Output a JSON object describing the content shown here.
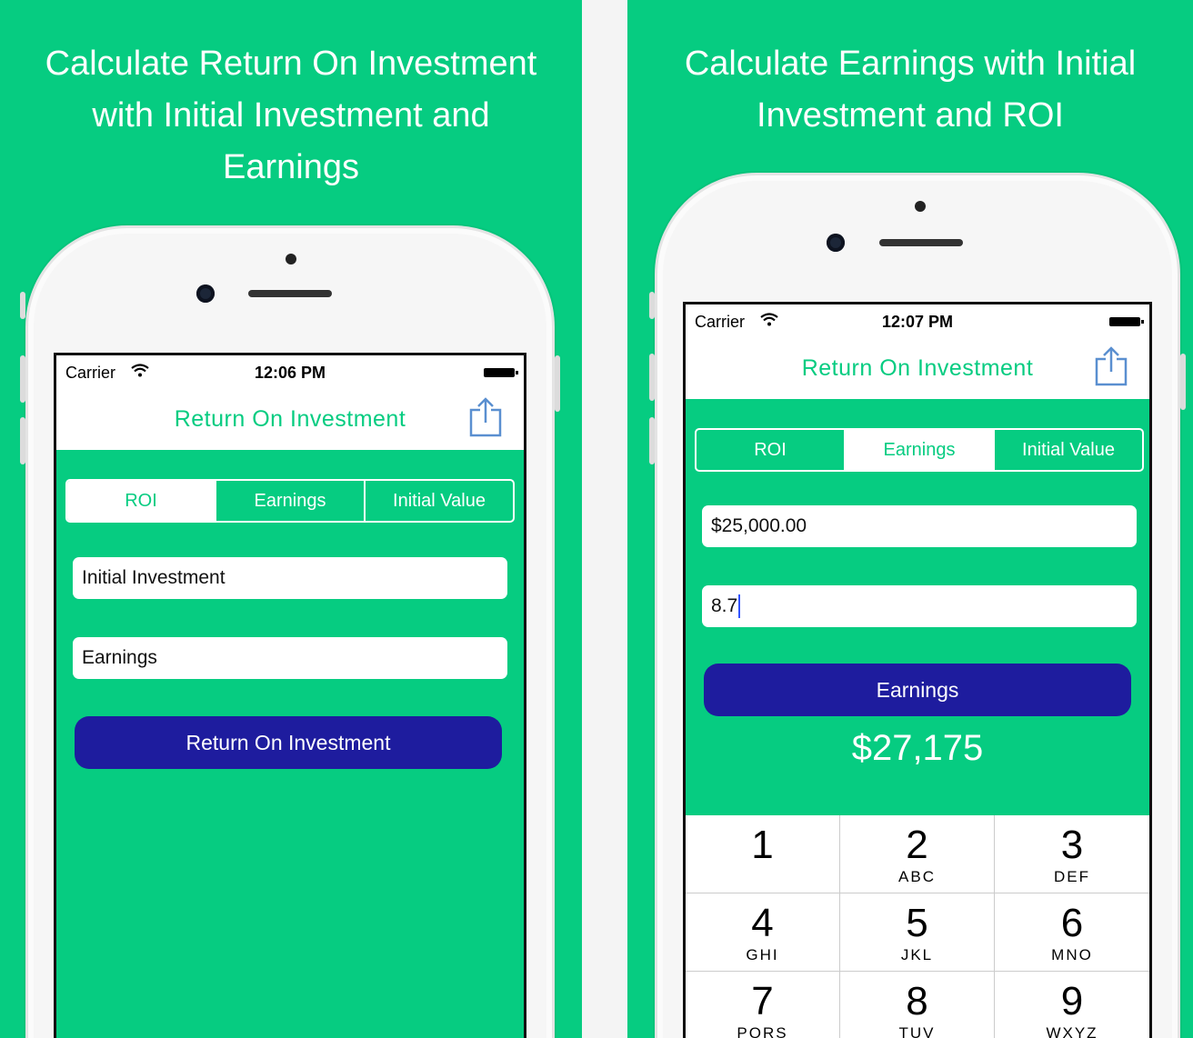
{
  "left": {
    "headline": "Calculate Return On Investment\nwith Initial Investment and\nEarnings",
    "status": {
      "carrier": "Carrier",
      "wifi_icon": "wifi-icon",
      "time": "12:06 PM"
    },
    "nav_title": "Return On Investment",
    "segments": [
      "ROI",
      "Earnings",
      "Initial Value"
    ],
    "selected_segment": "ROI",
    "fields": [
      {
        "placeholder": "Initial Investment",
        "value": ""
      },
      {
        "placeholder": "Earnings",
        "value": ""
      }
    ],
    "button": "Return On Investment"
  },
  "right": {
    "headline": "Calculate Earnings with Initial\nInvestment and ROI",
    "status": {
      "carrier": "Carrier",
      "wifi_icon": "wifi-icon",
      "time": "12:07 PM"
    },
    "nav_title": "Return On Investment",
    "segments": [
      "ROI",
      "Earnings",
      "Initial Value"
    ],
    "selected_segment": "Earnings",
    "fields": [
      {
        "placeholder": "",
        "value": "$25,000.00"
      },
      {
        "placeholder": "",
        "value": "8.7"
      }
    ],
    "button": "Earnings",
    "result": "$27,175",
    "keypad": [
      {
        "digit": "1",
        "letters": ""
      },
      {
        "digit": "2",
        "letters": "ABC"
      },
      {
        "digit": "3",
        "letters": "DEF"
      },
      {
        "digit": "4",
        "letters": "GHI"
      },
      {
        "digit": "5",
        "letters": "JKL"
      },
      {
        "digit": "6",
        "letters": "MNO"
      },
      {
        "digit": "7",
        "letters": "PQRS"
      },
      {
        "digit": "8",
        "letters": "TUV"
      },
      {
        "digit": "9",
        "letters": "WXYZ"
      }
    ]
  },
  "colors": {
    "brand_green": "#06cc81",
    "button_blue": "#1e1c9e",
    "text_white": "#ffffff"
  }
}
